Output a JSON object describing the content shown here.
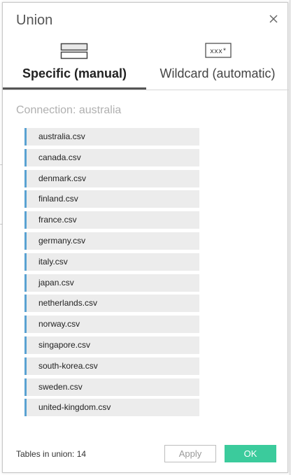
{
  "dialog": {
    "title": "Union"
  },
  "tabs": [
    {
      "label": "Specific (manual)",
      "active": true
    },
    {
      "label": "Wildcard (automatic)",
      "active": false,
      "icon_text": "xxx*"
    }
  ],
  "connection_label": "Connection: australia",
  "files": [
    "australia.csv",
    "canada.csv",
    "denmark.csv",
    "finland.csv",
    "france.csv",
    "germany.csv",
    "italy.csv",
    "japan.csv",
    "netherlands.csv",
    "norway.csv",
    "singapore.csv",
    "south-korea.csv",
    "sweden.csv",
    "united-kingdom.csv"
  ],
  "footer": {
    "tables_in_union": "Tables in union: 14",
    "apply_label": "Apply",
    "ok_label": "OK"
  },
  "colors": {
    "accent": "#5aa2d2",
    "ok_button": "#3bcb9c",
    "tab_underline": "#555555"
  }
}
